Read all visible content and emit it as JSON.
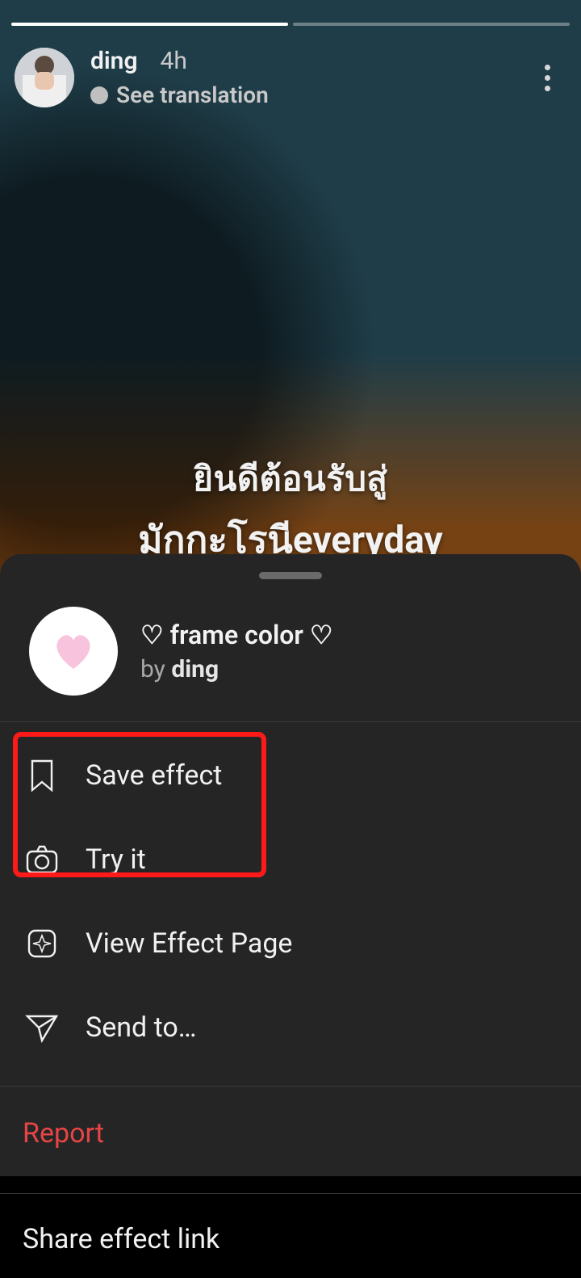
{
  "story": {
    "username": "ding",
    "time": "4h",
    "see_translation": "See translation",
    "caption_line1": "ยินดีต้อนรับสู่",
    "caption_line2": "มักกะโรนีeveryday"
  },
  "sheet": {
    "handle": "drag-handle",
    "effect_name": "♡ frame color ♡",
    "by_prefix": "by ",
    "author": "ding",
    "items": {
      "save": "Save effect",
      "try": "Try it",
      "view": "View Effect Page",
      "send": "Send to…"
    },
    "report": "Report",
    "share": "Share effect link"
  }
}
